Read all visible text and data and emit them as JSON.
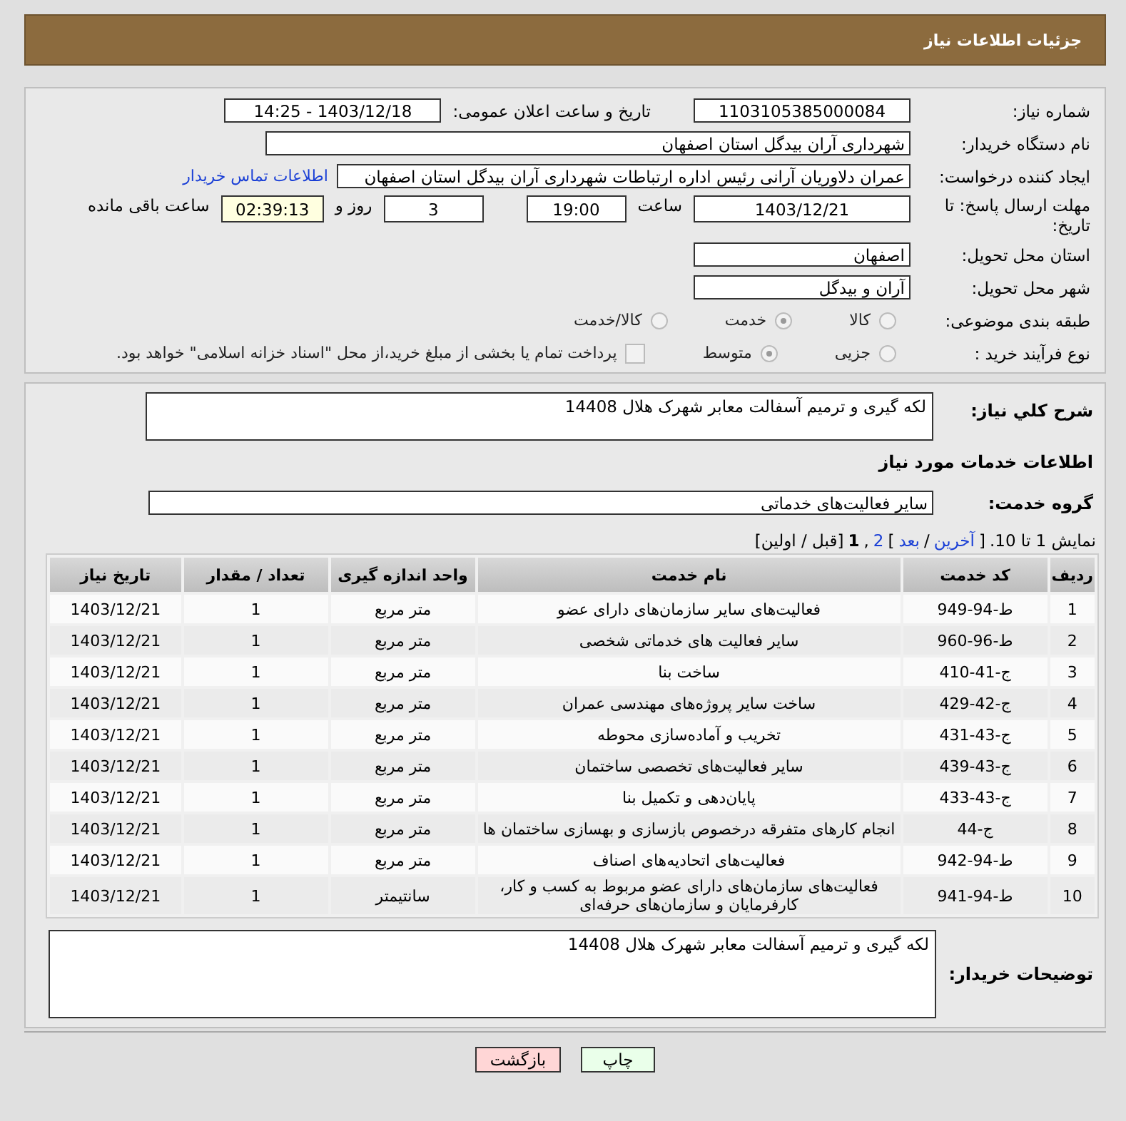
{
  "header": {
    "title": "جزئیات اطلاعات نیاز"
  },
  "details": {
    "need_number": {
      "label": "شماره نیاز:",
      "value": "1103105385000084"
    },
    "announce": {
      "label": "تاریخ و ساعت اعلان عمومی:",
      "value": "1403/12/18 - 14:25"
    },
    "buyer": {
      "label": "نام دستگاه خریدار:",
      "value": "شهرداری آران بیدگل استان اصفهان"
    },
    "creator": {
      "label": "ایجاد کننده درخواست:",
      "value": "عمران دلاوریان آرانی رئیس اداره ارتباطات شهرداری آران بیدگل استان اصفهان",
      "link": "اطلاعات تماس خریدار"
    },
    "deadline": {
      "label": "مهلت ارسال پاسخ: تا تاریخ:",
      "date": "1403/12/21",
      "time_label": "ساعت",
      "time": "19:00",
      "days": "3",
      "days_label": "روز و",
      "remaining": "02:39:13",
      "remaining_label": "ساعت باقی مانده"
    },
    "province": {
      "label": "استان محل تحویل:",
      "value": "اصفهان"
    },
    "city": {
      "label": "شهر محل تحویل:",
      "value": "آران و بیدگل"
    },
    "category": {
      "label": "طبقه بندی موضوعی:",
      "options": [
        {
          "label": "کالا",
          "selected": false
        },
        {
          "label": "خدمت",
          "selected": true
        },
        {
          "label": "کالا/خدمت",
          "selected": false
        }
      ]
    },
    "process": {
      "label": "نوع فرآیند خرید :",
      "options": [
        {
          "label": "جزیی",
          "selected": false
        },
        {
          "label": "متوسط",
          "selected": true
        }
      ],
      "payment": {
        "label": "پرداخت تمام یا بخشی از مبلغ خرید،از محل \"اسناد خزانه اسلامی\" خواهد بود.",
        "checked": false
      }
    }
  },
  "summary": {
    "label": "شرح کلي نياز:",
    "value": "لکه گیری و ترمیم آسفالت معابر شهرک هلال 14408"
  },
  "services_title": "اطلاعات خدمات مورد نیاز",
  "service_group": {
    "label": "گروه خدمت:",
    "value": "سایر فعالیت‌های خدماتی"
  },
  "pagination": [
    {
      "kind": "text",
      "text": "نمایش 1 تا 10."
    },
    {
      "kind": "text",
      "text": "["
    },
    {
      "kind": "link",
      "text": "آخرین"
    },
    {
      "kind": "text",
      "text": "/"
    },
    {
      "kind": "link",
      "text": "بعد"
    },
    {
      "kind": "text",
      "text": "]"
    },
    {
      "kind": "link",
      "text": "2"
    },
    {
      "kind": "text",
      "text": ","
    },
    {
      "kind": "current",
      "text": "1"
    },
    {
      "kind": "text",
      "text": "[قبل / اولین]"
    }
  ],
  "table": {
    "columns": [
      "ردیف",
      "کد خدمت",
      "نام خدمت",
      "واحد اندازه گیری",
      "تعداد / مقدار",
      "تاریخ نیاز"
    ],
    "rows": [
      [
        "1",
        "ط-94-949",
        "فعالیت‌های سایر سازمان‌های دارای عضو",
        "متر مربع",
        "1",
        "1403/12/21"
      ],
      [
        "2",
        "ط-96-960",
        "سایر فعالیت های خدماتی شخصی",
        "متر مربع",
        "1",
        "1403/12/21"
      ],
      [
        "3",
        "ج-41-410",
        "ساخت بنا",
        "متر مربع",
        "1",
        "1403/12/21"
      ],
      [
        "4",
        "ج-42-429",
        "ساخت سایر پروژه‌های مهندسی عمران",
        "متر مربع",
        "1",
        "1403/12/21"
      ],
      [
        "5",
        "ج-43-431",
        "تخریب و آماده‌سازی محوطه",
        "متر مربع",
        "1",
        "1403/12/21"
      ],
      [
        "6",
        "ج-43-439",
        "سایر فعالیت‌های تخصصی ساختمان",
        "متر مربع",
        "1",
        "1403/12/21"
      ],
      [
        "7",
        "ج-43-433",
        "پایان‌دهی و تکمیل بنا",
        "متر مربع",
        "1",
        "1403/12/21"
      ],
      [
        "8",
        "ج-44",
        "انجام کارهای متفرقه درخصوص بازسازی و بهسازی ساختمان ها",
        "متر مربع",
        "1",
        "1403/12/21"
      ],
      [
        "9",
        "ط-94-942",
        "فعالیت‌های اتحادیه‌های اصناف",
        "متر مربع",
        "1",
        "1403/12/21"
      ],
      [
        "10",
        "ط-94-941",
        "فعالیت‌های سازمان‌های دارای عضو مربوط به کسب و کار، کارفرمایان و سازمان‌های حرفه‌ای",
        "سانتیمتر",
        "1",
        "1403/12/21"
      ]
    ]
  },
  "buyer_notes": {
    "label": "توضیحات خریدار:",
    "value": "لکه گیری و ترمیم آسفالت معابر شهرک هلال 14408"
  },
  "buttons": [
    {
      "label": "چاپ",
      "kind": "print"
    },
    {
      "label": "بازگشت",
      "kind": "back"
    }
  ]
}
